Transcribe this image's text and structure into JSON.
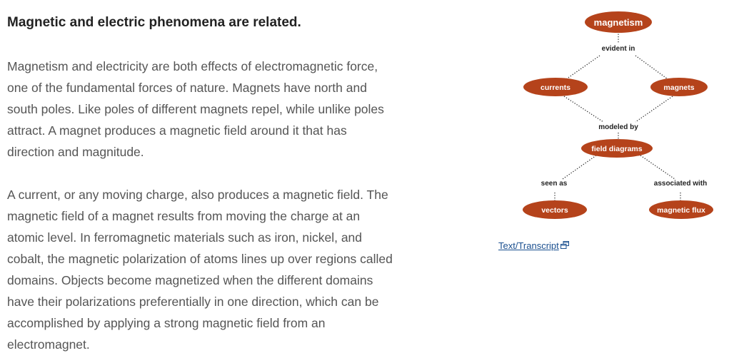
{
  "heading": "Magnetic and electric phenomena are related.",
  "paragraphs": [
    "Magnetism and electricity are both effects of electromagnetic force, one of the fundamental forces of nature. Magnets have north and south poles. Like poles of different magnets repel, while unlike poles attract. A magnet produces a magnetic field around it that has direction and magnitude.",
    "A current, or any moving charge, also produces a magnetic field. The magnetic field of a magnet results from moving the charge at an atomic level. In ferromagnetic materials such as iron, nickel, and cobalt, the magnetic polarization of atoms lines up over regions called domains. Objects become magnetized when the different domains have their polarizations preferentially in one direction, which can be accomplished by applying a strong magnetic field from an electromagnet."
  ],
  "concept_map": {
    "node_color": "#b5431b",
    "link_color": "#333333",
    "nodes": {
      "magnetism": "magnetism",
      "currents": "currents",
      "magnets": "magnets",
      "field_diagrams": "field diagrams",
      "vectors": "vectors",
      "magnetic_flux": "magnetic flux"
    },
    "links": {
      "evident_in": "evident in",
      "modeled_by": "modeled by",
      "seen_as": "seen as",
      "associated_with": "associated with"
    }
  },
  "transcript_link": {
    "label": "Text/Transcript",
    "icon": "external-window-icon"
  }
}
